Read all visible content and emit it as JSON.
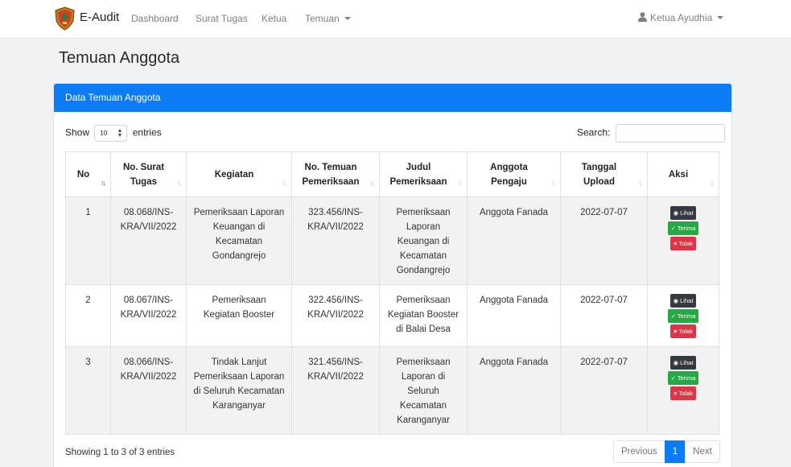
{
  "nav": {
    "brand": "E-Audit",
    "links": [
      "Dashboard",
      "Surat Tugas",
      "Ketua",
      "Temuan"
    ],
    "user": "Ketua Ayudhia"
  },
  "page": {
    "title": "Temuan Anggota"
  },
  "card": {
    "header": "Data Temuan Anggota",
    "length": {
      "prefix": "Show",
      "value": "10",
      "suffix": "entries"
    },
    "search_label": "Search:",
    "search_value": ""
  },
  "table": {
    "columns": [
      [
        "No"
      ],
      [
        "No. Surat",
        "Tugas"
      ],
      [
        "Kegiatan"
      ],
      [
        "No. Temuan",
        "Pemeriksaan"
      ],
      [
        "Judul",
        "Pemeriksaan"
      ],
      [
        "Anggota",
        "Pengaju"
      ],
      [
        "Tanggal",
        "Upload"
      ],
      [
        "Aksi"
      ]
    ],
    "rows": [
      {
        "no": "1",
        "surat": [
          "08.068/INS-",
          "KRA/VII/2022"
        ],
        "kegiatan": [
          "Pemeriksaan Laporan",
          "Keuangan di",
          "Kecamatan",
          "Gondangrejo"
        ],
        "temuan": [
          "323.456/INS-",
          "KRA/VII/2022"
        ],
        "judul": [
          "Pemeriksaan",
          "Laporan",
          "Keuangan di",
          "Kecamatan",
          "Gondangrejo"
        ],
        "anggota": "Anggota Fanada",
        "tanggal": "2022-07-07"
      },
      {
        "no": "2",
        "surat": [
          "08.067/INS-",
          "KRA/VII/2022"
        ],
        "kegiatan": [
          "Pemeriksaan",
          "Kegiatan Booster"
        ],
        "temuan": [
          "322.456/INS-",
          "KRA/VII/2022"
        ],
        "judul": [
          "Pemeriksaan",
          "Kegiatan Booster",
          "di Balai Desa"
        ],
        "anggota": "Anggota Fanada",
        "tanggal": "2022-07-07"
      },
      {
        "no": "3",
        "surat": [
          "08.066/INS-",
          "KRA/VII/2022"
        ],
        "kegiatan": [
          "Tindak Lanjut",
          "Pemeriksaan Laporan",
          "di Seluruh Kecamatan",
          "Karanganyar"
        ],
        "temuan": [
          "321.456/INS-",
          "KRA/VII/2022"
        ],
        "judul": [
          "Pemeriksaan",
          "Laporan di",
          "Seluruh",
          "Kecamatan",
          "Karanganyar"
        ],
        "anggota": "Anggota Fanada",
        "tanggal": "2022-07-07"
      }
    ],
    "actions": {
      "view": "Lihat",
      "accept": "Terima",
      "reject": "Tolak"
    }
  },
  "footer": {
    "info": "Showing 1 to 3 of 3 entries",
    "prev": "Previous",
    "page": "1",
    "next": "Next"
  },
  "colors": {
    "primary": "#0b7cf5",
    "success": "#28a745",
    "danger": "#dc3545",
    "dark": "#343a40"
  }
}
